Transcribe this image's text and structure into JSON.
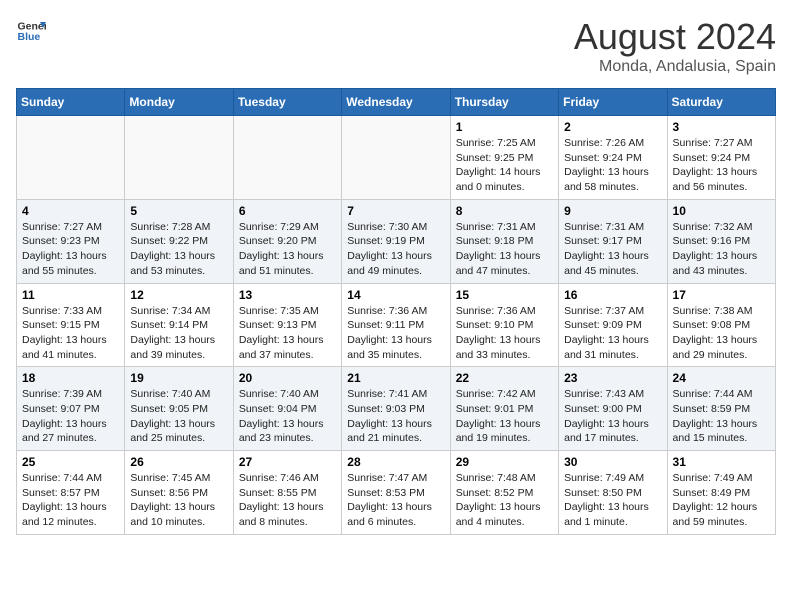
{
  "logo": {
    "text_general": "General",
    "text_blue": "Blue"
  },
  "header": {
    "month_year": "August 2024",
    "location": "Monda, Andalusia, Spain"
  },
  "weekdays": [
    "Sunday",
    "Monday",
    "Tuesday",
    "Wednesday",
    "Thursday",
    "Friday",
    "Saturday"
  ],
  "weeks": [
    [
      {
        "day": "",
        "info": ""
      },
      {
        "day": "",
        "info": ""
      },
      {
        "day": "",
        "info": ""
      },
      {
        "day": "",
        "info": ""
      },
      {
        "day": "1",
        "info": "Sunrise: 7:25 AM\nSunset: 9:25 PM\nDaylight: 14 hours and 0 minutes."
      },
      {
        "day": "2",
        "info": "Sunrise: 7:26 AM\nSunset: 9:24 PM\nDaylight: 13 hours and 58 minutes."
      },
      {
        "day": "3",
        "info": "Sunrise: 7:27 AM\nSunset: 9:24 PM\nDaylight: 13 hours and 56 minutes."
      }
    ],
    [
      {
        "day": "4",
        "info": "Sunrise: 7:27 AM\nSunset: 9:23 PM\nDaylight: 13 hours and 55 minutes."
      },
      {
        "day": "5",
        "info": "Sunrise: 7:28 AM\nSunset: 9:22 PM\nDaylight: 13 hours and 53 minutes."
      },
      {
        "day": "6",
        "info": "Sunrise: 7:29 AM\nSunset: 9:20 PM\nDaylight: 13 hours and 51 minutes."
      },
      {
        "day": "7",
        "info": "Sunrise: 7:30 AM\nSunset: 9:19 PM\nDaylight: 13 hours and 49 minutes."
      },
      {
        "day": "8",
        "info": "Sunrise: 7:31 AM\nSunset: 9:18 PM\nDaylight: 13 hours and 47 minutes."
      },
      {
        "day": "9",
        "info": "Sunrise: 7:31 AM\nSunset: 9:17 PM\nDaylight: 13 hours and 45 minutes."
      },
      {
        "day": "10",
        "info": "Sunrise: 7:32 AM\nSunset: 9:16 PM\nDaylight: 13 hours and 43 minutes."
      }
    ],
    [
      {
        "day": "11",
        "info": "Sunrise: 7:33 AM\nSunset: 9:15 PM\nDaylight: 13 hours and 41 minutes."
      },
      {
        "day": "12",
        "info": "Sunrise: 7:34 AM\nSunset: 9:14 PM\nDaylight: 13 hours and 39 minutes."
      },
      {
        "day": "13",
        "info": "Sunrise: 7:35 AM\nSunset: 9:13 PM\nDaylight: 13 hours and 37 minutes."
      },
      {
        "day": "14",
        "info": "Sunrise: 7:36 AM\nSunset: 9:11 PM\nDaylight: 13 hours and 35 minutes."
      },
      {
        "day": "15",
        "info": "Sunrise: 7:36 AM\nSunset: 9:10 PM\nDaylight: 13 hours and 33 minutes."
      },
      {
        "day": "16",
        "info": "Sunrise: 7:37 AM\nSunset: 9:09 PM\nDaylight: 13 hours and 31 minutes."
      },
      {
        "day": "17",
        "info": "Sunrise: 7:38 AM\nSunset: 9:08 PM\nDaylight: 13 hours and 29 minutes."
      }
    ],
    [
      {
        "day": "18",
        "info": "Sunrise: 7:39 AM\nSunset: 9:07 PM\nDaylight: 13 hours and 27 minutes."
      },
      {
        "day": "19",
        "info": "Sunrise: 7:40 AM\nSunset: 9:05 PM\nDaylight: 13 hours and 25 minutes."
      },
      {
        "day": "20",
        "info": "Sunrise: 7:40 AM\nSunset: 9:04 PM\nDaylight: 13 hours and 23 minutes."
      },
      {
        "day": "21",
        "info": "Sunrise: 7:41 AM\nSunset: 9:03 PM\nDaylight: 13 hours and 21 minutes."
      },
      {
        "day": "22",
        "info": "Sunrise: 7:42 AM\nSunset: 9:01 PM\nDaylight: 13 hours and 19 minutes."
      },
      {
        "day": "23",
        "info": "Sunrise: 7:43 AM\nSunset: 9:00 PM\nDaylight: 13 hours and 17 minutes."
      },
      {
        "day": "24",
        "info": "Sunrise: 7:44 AM\nSunset: 8:59 PM\nDaylight: 13 hours and 15 minutes."
      }
    ],
    [
      {
        "day": "25",
        "info": "Sunrise: 7:44 AM\nSunset: 8:57 PM\nDaylight: 13 hours and 12 minutes."
      },
      {
        "day": "26",
        "info": "Sunrise: 7:45 AM\nSunset: 8:56 PM\nDaylight: 13 hours and 10 minutes."
      },
      {
        "day": "27",
        "info": "Sunrise: 7:46 AM\nSunset: 8:55 PM\nDaylight: 13 hours and 8 minutes."
      },
      {
        "day": "28",
        "info": "Sunrise: 7:47 AM\nSunset: 8:53 PM\nDaylight: 13 hours and 6 minutes."
      },
      {
        "day": "29",
        "info": "Sunrise: 7:48 AM\nSunset: 8:52 PM\nDaylight: 13 hours and 4 minutes."
      },
      {
        "day": "30",
        "info": "Sunrise: 7:49 AM\nSunset: 8:50 PM\nDaylight: 13 hours and 1 minute."
      },
      {
        "day": "31",
        "info": "Sunrise: 7:49 AM\nSunset: 8:49 PM\nDaylight: 12 hours and 59 minutes."
      }
    ]
  ]
}
